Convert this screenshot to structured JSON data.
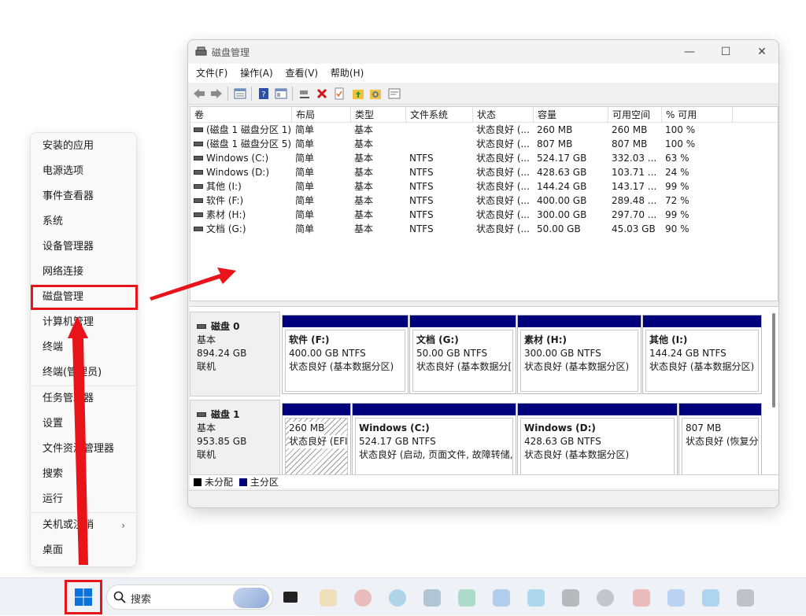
{
  "context_menu": {
    "items": [
      {
        "label": "安装的应用"
      },
      {
        "label": "电源选项"
      },
      {
        "label": "事件查看器"
      },
      {
        "label": "系统"
      },
      {
        "label": "设备管理器"
      },
      {
        "label": "网络连接"
      },
      {
        "label": "磁盘管理"
      },
      {
        "label": "计算机管理"
      },
      {
        "label": "终端"
      },
      {
        "label": "终端(管理员)"
      },
      {
        "label": "任务管理器"
      },
      {
        "label": "设置"
      },
      {
        "label": "文件资源管理器"
      },
      {
        "label": "搜索"
      },
      {
        "label": "运行"
      },
      {
        "label": "关机或注销"
      },
      {
        "label": "桌面"
      }
    ],
    "submenu_arrow": "›"
  },
  "window": {
    "title": "磁盘管理",
    "controls": {
      "minimize": "—",
      "maximize": "☐",
      "close": "✕"
    },
    "menu": [
      "文件(F)",
      "操作(A)",
      "查看(V)",
      "帮助(H)"
    ],
    "toolbar_icons": [
      "back-arrow-icon",
      "forward-arrow-icon",
      "list-view-icon",
      "help-icon",
      "properties-icon",
      "connect-icon",
      "delete-icon",
      "check-icon",
      "folder-up-icon",
      "folder-search-icon",
      "properties-panel-icon"
    ]
  },
  "volume_table": {
    "headers": [
      "卷",
      "布局",
      "类型",
      "文件系统",
      "状态",
      "容量",
      "可用空间",
      "% 可用"
    ],
    "rows": [
      [
        "(磁盘 1 磁盘分区 1)",
        "简单",
        "基本",
        "",
        "状态良好 (...",
        "260 MB",
        "260 MB",
        "100 %"
      ],
      [
        "(磁盘 1 磁盘分区 5)",
        "简单",
        "基本",
        "",
        "状态良好 (...",
        "807 MB",
        "807 MB",
        "100 %"
      ],
      [
        "Windows (C:)",
        "简单",
        "基本",
        "NTFS",
        "状态良好 (...",
        "524.17 GB",
        "332.03 ...",
        "63 %"
      ],
      [
        "Windows (D:)",
        "简单",
        "基本",
        "NTFS",
        "状态良好 (...",
        "428.63 GB",
        "103.71 ...",
        "24 %"
      ],
      [
        "其他 (I:)",
        "简单",
        "基本",
        "NTFS",
        "状态良好 (...",
        "144.24 GB",
        "143.17 ...",
        "99 %"
      ],
      [
        "软件 (F:)",
        "简单",
        "基本",
        "NTFS",
        "状态良好 (...",
        "400.00 GB",
        "289.48 ...",
        "72 %"
      ],
      [
        "素材 (H:)",
        "简单",
        "基本",
        "NTFS",
        "状态良好 (...",
        "300.00 GB",
        "297.70 ...",
        "99 %"
      ],
      [
        "文档 (G:)",
        "简单",
        "基本",
        "NTFS",
        "状态良好 (...",
        "50.00 GB",
        "45.03 GB",
        "90 %"
      ]
    ]
  },
  "disks": [
    {
      "name": "磁盘 0",
      "type": "基本",
      "size": "894.24 GB",
      "status": "联机",
      "partitions": [
        {
          "title": "软件  (F:)",
          "size": "400.00 GB NTFS",
          "status": "状态良好 (基本数据分区)"
        },
        {
          "title": "文档  (G:)",
          "size": "50.00 GB NTFS",
          "status": "状态良好 (基本数据分["
        },
        {
          "title": "素材  (H:)",
          "size": "300.00 GB NTFS",
          "status": "状态良好 (基本数据分区)"
        },
        {
          "title": "其他  (I:)",
          "size": "144.24 GB NTFS",
          "status": "状态良好 (基本数据分区)"
        }
      ]
    },
    {
      "name": "磁盘 1",
      "type": "基本",
      "size": "953.85 GB",
      "status": "联机",
      "partitions": [
        {
          "title": "",
          "size": "260 MB",
          "status": "状态良好 (EFI"
        },
        {
          "title": "Windows  (C:)",
          "size": "524.17 GB NTFS",
          "status": "状态良好 (启动, 页面文件, 故障转储,"
        },
        {
          "title": "Windows  (D:)",
          "size": "428.63 GB NTFS",
          "status": "状态良好 (基本数据分区)"
        },
        {
          "title": "",
          "size": "807 MB",
          "status": "状态良好 (恢复分"
        }
      ]
    }
  ],
  "legend": {
    "unallocated": "未分配",
    "primary": "主分区",
    "unallocated_color": "#000000",
    "primary_color": "#00007d"
  },
  "taskbar": {
    "search_placeholder": "搜索"
  },
  "colors": {
    "annotation_red": "#e8141a",
    "partition_bar": "#00007d",
    "start_blue": "#0067c0"
  }
}
